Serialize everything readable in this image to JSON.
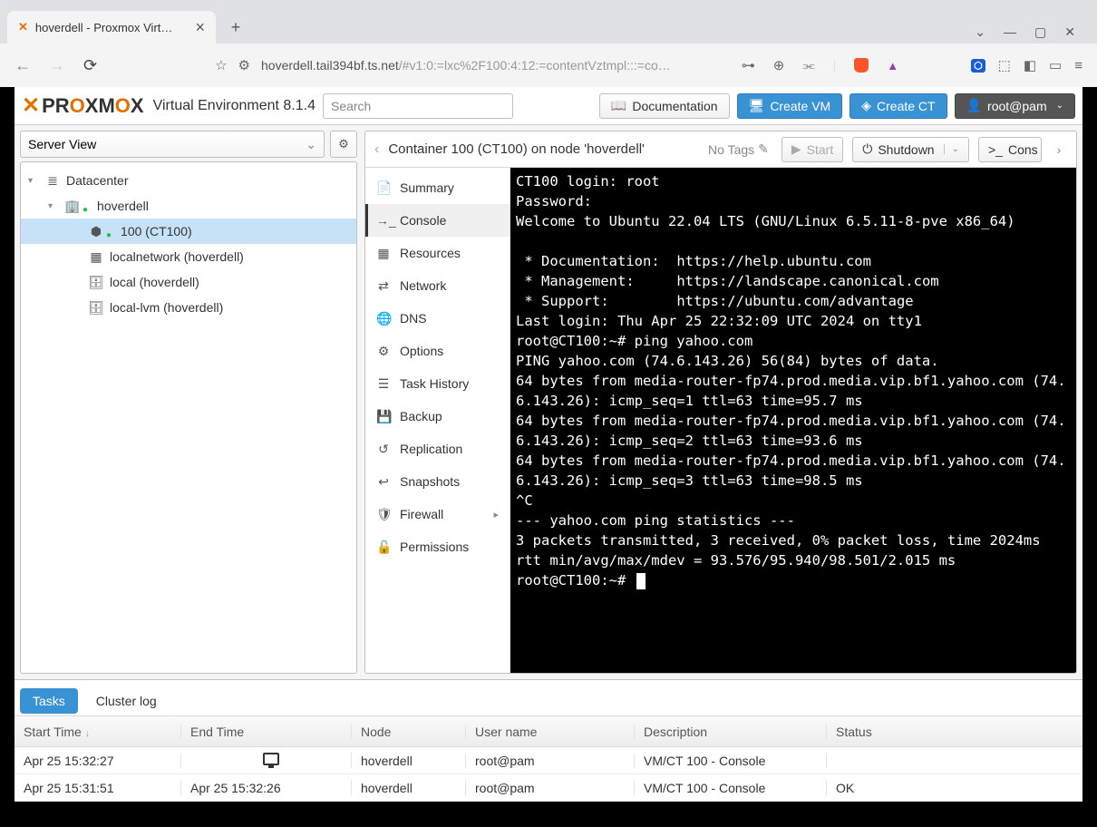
{
  "browser": {
    "tab_title": "hoverdell - Proxmox Virt…",
    "url_host": "hoverdell.tail394bf.ts.net",
    "url_path": "/#v1:0:=lxc%2F100:4:12:=contentVztmpl:::=co…"
  },
  "header": {
    "env_label": "Virtual Environment 8.1.4",
    "search_placeholder": "Search",
    "doc_btn": "Documentation",
    "create_vm_btn": "Create VM",
    "create_ct_btn": "Create CT",
    "user_btn": "root@pam"
  },
  "sidebar": {
    "view_label": "Server View",
    "tree": [
      {
        "label": "Datacenter",
        "icon": "server",
        "indent": 0,
        "expand": "▾"
      },
      {
        "label": "hoverdell",
        "icon": "building",
        "indent": 1,
        "expand": "▾",
        "status": "up"
      },
      {
        "label": "100 (CT100)",
        "icon": "cube",
        "indent": 2,
        "selected": true,
        "status": "up"
      },
      {
        "label": "localnetwork (hoverdell)",
        "icon": "grid",
        "indent": 2
      },
      {
        "label": "local (hoverdell)",
        "icon": "db",
        "indent": 2
      },
      {
        "label": "local-lvm (hoverdell)",
        "icon": "db",
        "indent": 2
      }
    ]
  },
  "content": {
    "title": "Container 100 (CT100) on node 'hoverdell'",
    "no_tags": "No Tags",
    "btn_start": "Start",
    "btn_shutdown": "Shutdown",
    "btn_console": "Cons",
    "subnav": [
      {
        "label": "Summary",
        "icon": "📄"
      },
      {
        "label": "Console",
        "icon": "→_",
        "active": true
      },
      {
        "label": "Resources",
        "icon": "▦"
      },
      {
        "label": "Network",
        "icon": "⇄"
      },
      {
        "label": "DNS",
        "icon": "🌐"
      },
      {
        "label": "Options",
        "icon": "⚙"
      },
      {
        "label": "Task History",
        "icon": "☰"
      },
      {
        "label": "Backup",
        "icon": "💾"
      },
      {
        "label": "Replication",
        "icon": "↺"
      },
      {
        "label": "Snapshots",
        "icon": "↩"
      },
      {
        "label": "Firewall",
        "icon": "🛡",
        "arrow": true
      },
      {
        "label": "Permissions",
        "icon": "🔓"
      }
    ]
  },
  "console_text": "CT100 login: root\nPassword:\nWelcome to Ubuntu 22.04 LTS (GNU/Linux 6.5.11-8-pve x86_64)\n\n * Documentation:  https://help.ubuntu.com\n * Management:     https://landscape.canonical.com\n * Support:        https://ubuntu.com/advantage\nLast login: Thu Apr 25 22:32:09 UTC 2024 on tty1\nroot@CT100:~# ping yahoo.com\nPING yahoo.com (74.6.143.26) 56(84) bytes of data.\n64 bytes from media-router-fp74.prod.media.vip.bf1.yahoo.com (74.6.143.26): icmp_seq=1 ttl=63 time=95.7 ms\n64 bytes from media-router-fp74.prod.media.vip.bf1.yahoo.com (74.6.143.26): icmp_seq=2 ttl=63 time=93.6 ms\n64 bytes from media-router-fp74.prod.media.vip.bf1.yahoo.com (74.6.143.26): icmp_seq=3 ttl=63 time=98.5 ms\n^C\n--- yahoo.com ping statistics ---\n3 packets transmitted, 3 received, 0% packet loss, time 2024ms\nrtt min/avg/max/mdev = 93.576/95.940/98.501/2.015 ms\nroot@CT100:~# ",
  "tasks": {
    "tab_tasks": "Tasks",
    "tab_cluster": "Cluster log",
    "cols": {
      "start": "Start Time",
      "end": "End Time",
      "node": "Node",
      "user": "User name",
      "desc": "Description",
      "status": "Status"
    },
    "rows": [
      {
        "start": "Apr 25 15:32:27",
        "end_icon": true,
        "node": "hoverdell",
        "user": "root@pam",
        "desc": "VM/CT 100 - Console",
        "status": ""
      },
      {
        "start": "Apr 25 15:31:51",
        "end": "Apr 25 15:32:26",
        "node": "hoverdell",
        "user": "root@pam",
        "desc": "VM/CT 100 - Console",
        "status": "OK"
      }
    ]
  }
}
